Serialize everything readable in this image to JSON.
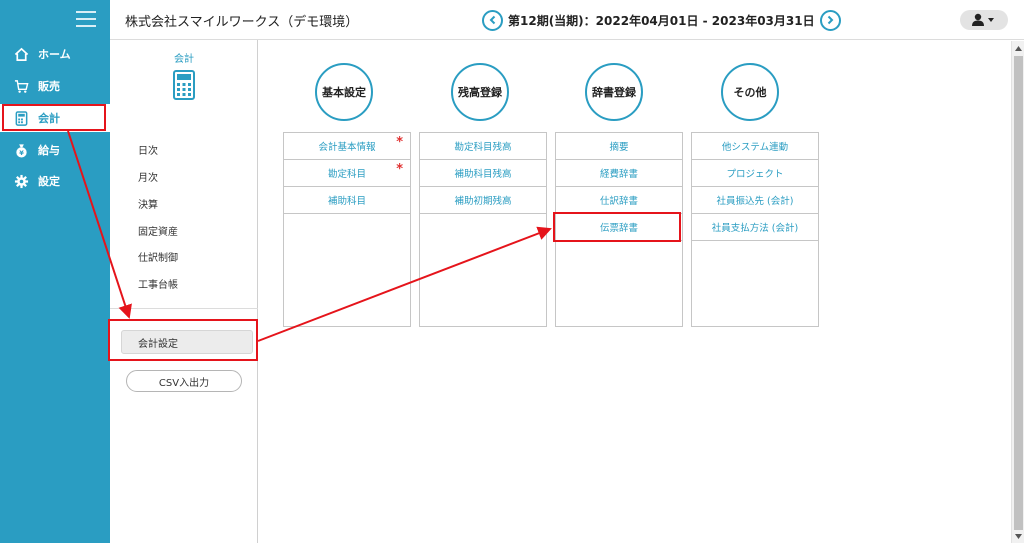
{
  "app": {
    "company_name": "株式会社スマイルワークス（デモ環境）",
    "period_text": "第12期(当期)：2022年04月01日 - 2023年03月31日"
  },
  "nav": {
    "items": [
      {
        "label": "ホーム",
        "icon": "home-icon"
      },
      {
        "label": "販売",
        "icon": "cart-icon"
      },
      {
        "label": "会計",
        "icon": "calculator-icon",
        "active": true
      },
      {
        "label": "給与",
        "icon": "money-bag-icon"
      },
      {
        "label": "設定",
        "icon": "gear-icon"
      }
    ]
  },
  "submenu": {
    "title": "会計",
    "links": [
      "日次",
      "月次",
      "決算",
      "固定資産",
      "仕訳制御",
      "工事台帳"
    ],
    "active_item": "会計設定",
    "csv_button": "CSV入出力"
  },
  "columns": [
    {
      "title": "基本設定",
      "items": [
        {
          "label": "会計基本情報",
          "required": true
        },
        {
          "label": "勘定科目",
          "required": true
        },
        {
          "label": "補助科目",
          "required": false
        }
      ]
    },
    {
      "title": "残高登録",
      "items": [
        {
          "label": "勘定科目残高"
        },
        {
          "label": "補助科目残高"
        },
        {
          "label": "補助初期残高"
        }
      ]
    },
    {
      "title": "辞書登録",
      "items": [
        {
          "label": "摘要"
        },
        {
          "label": "経費辞書"
        },
        {
          "label": "仕訳辞書"
        },
        {
          "label": "伝票辞書"
        }
      ]
    },
    {
      "title": "その他",
      "items": [
        {
          "label": "他システム連動"
        },
        {
          "label": "プロジェクト"
        },
        {
          "label": "社員振込先 (会計)"
        },
        {
          "label": "社員支払方法 (会計)"
        }
      ]
    }
  ],
  "required_mark": "*",
  "colors": {
    "accent": "#2a9dc2",
    "required": "#e03030",
    "annotation": "#e5141b",
    "nav_bg": "#2a9dc2"
  }
}
